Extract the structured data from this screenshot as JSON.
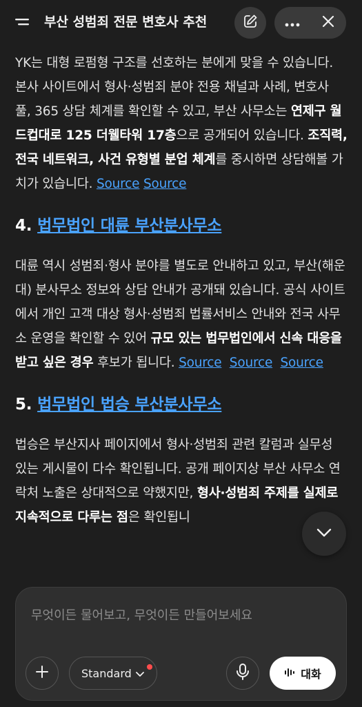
{
  "header": {
    "title": "부산 성범죄 전문 변호사 추천",
    "icons": [
      "menu-icon",
      "edit-icon",
      "more-icon",
      "close-icon"
    ]
  },
  "content": {
    "p1": {
      "t1": "YK는 대형 로펌형 구조를 선호하는 분에게 맞을 수 있습니다. 본사 사이트에서 형사·성범죄 분야 전용 채널과 사례, 변호사 풀, 365 상담 체계를 확인할 수 있고, 부산 사무소는 ",
      "b1": "연제구 월드컵대로 125 더웰타워 17층",
      "t2": "으로 공개되어 있습니다. ",
      "b2": "조직력, 전국 네트워크, 사건 유형별 분업 체계",
      "t3": "를 중시하면 상담해볼 가치가 있습니다. ",
      "sources": [
        "Source",
        "Source"
      ]
    },
    "h4": {
      "num": "4. ",
      "link": "법무법인 대륜 부산분사무소"
    },
    "p2": {
      "t1": "대륜 역시 성범죄·형사 분야를 별도로 안내하고 있고, 부산(해운대) 분사무소 정보와 상담 안내가 공개돼 있습니다. 공식 사이트에서 개인 고객 대상 형사·성범죄 법률서비스 안내와 전국 사무소 운영을 확인할 수 있어 ",
      "b1": "규모 있는 법무법인에서 신속 대응을 받고 싶은 경우",
      "t2": " 후보가 됩니다. ",
      "sources": [
        "Source",
        "Source",
        "Source"
      ]
    },
    "h5": {
      "num": "5. ",
      "link": "법무법인 법승 부산분사무소"
    },
    "p3": {
      "t1": "법승은 부산지사 페이지에서 형사·성범죄 관련 칼럼과 실무성 있는 게시물이 다수 확인됩니다. 공개 페이지상 부산 사무소 연락처 노출은 상대적으로 약했지만, ",
      "b1": "형사·성범죄 주제를 실제로 지속적으로 다루는 점",
      "t2": "은 확인됩니"
    }
  },
  "composer": {
    "placeholder": "무엇이든 물어보고, 무엇이든 만들어보세요",
    "model_label": "Standard",
    "talk_label": "대화"
  },
  "colors": {
    "link": "#4aa3ff",
    "background": "#1e1e1e",
    "notification_dot": "#ff4d4d"
  }
}
